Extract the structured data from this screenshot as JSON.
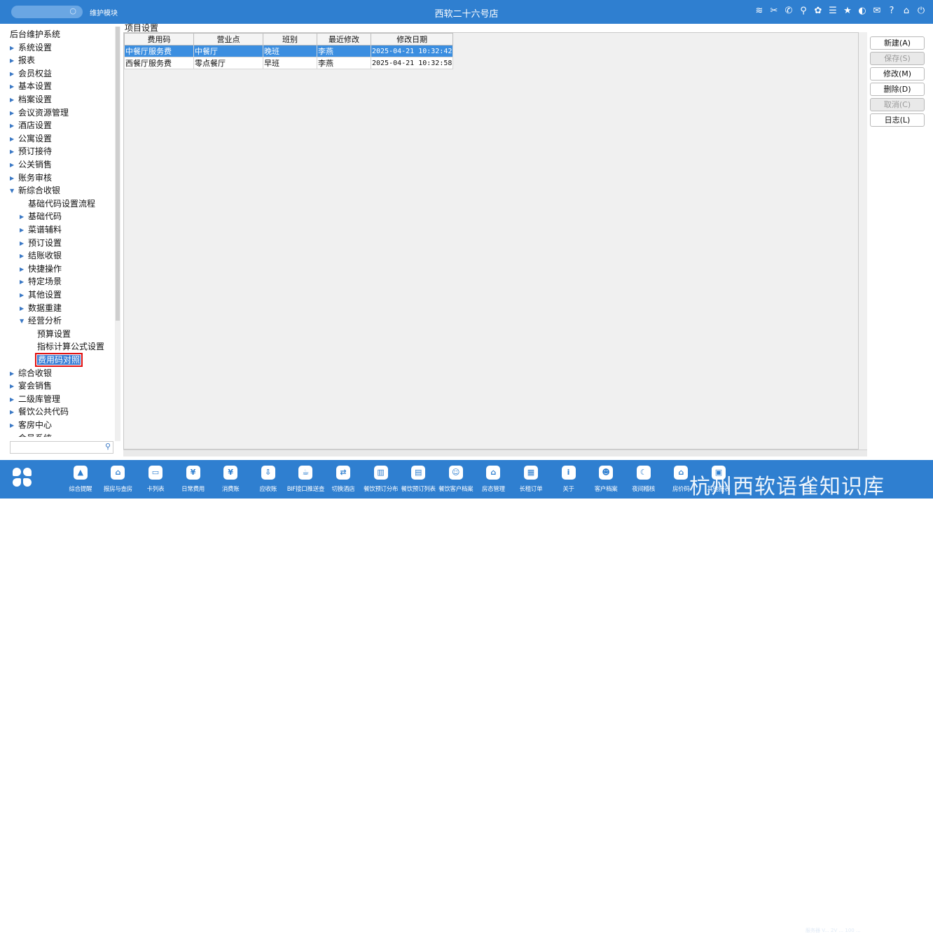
{
  "topbar": {
    "module": "维护模块",
    "title": "西软二十六号店",
    "icons": [
      "wifi-icon",
      "tools-icon",
      "phone-icon",
      "help-search-icon",
      "palette-icon",
      "menu-icon",
      "star-icon",
      "theme-icon",
      "mail-icon",
      "question-icon",
      "home-icon",
      "power-icon"
    ]
  },
  "tree": {
    "root": "后台维护系统",
    "items": [
      {
        "label": "系统设置",
        "arrow": "▶"
      },
      {
        "label": "报表",
        "arrow": "▶"
      },
      {
        "label": "会员权益",
        "arrow": "▶"
      },
      {
        "label": "基本设置",
        "arrow": "▶"
      },
      {
        "label": "档案设置",
        "arrow": "▶"
      },
      {
        "label": "会议资源管理",
        "arrow": "▶"
      },
      {
        "label": "酒店设置",
        "arrow": "▶"
      },
      {
        "label": "公寓设置",
        "arrow": "▶"
      },
      {
        "label": "预订接待",
        "arrow": "▶"
      },
      {
        "label": "公关销售",
        "arrow": "▶"
      },
      {
        "label": "账务审核",
        "arrow": "▶"
      },
      {
        "label": "新综合收银",
        "arrow": "▼"
      },
      {
        "label": "基础代码设置流程",
        "arrow": ""
      },
      {
        "label": "基础代码",
        "arrow": "▶"
      },
      {
        "label": "菜谱辅料",
        "arrow": "▶"
      },
      {
        "label": "预订设置",
        "arrow": "▶"
      },
      {
        "label": "结账收银",
        "arrow": "▶"
      },
      {
        "label": "快捷操作",
        "arrow": "▶"
      },
      {
        "label": "特定场景",
        "arrow": "▶"
      },
      {
        "label": "其他设置",
        "arrow": "▶"
      },
      {
        "label": "数据重建",
        "arrow": "▶"
      },
      {
        "label": "经营分析",
        "arrow": "▼"
      },
      {
        "label": "预算设置",
        "arrow": ""
      },
      {
        "label": "指标计算公式设置",
        "arrow": ""
      },
      {
        "label": "费用码对照",
        "arrow": ""
      },
      {
        "label": "综合收银",
        "arrow": "▶"
      },
      {
        "label": "宴会销售",
        "arrow": "▶"
      },
      {
        "label": "二级库管理",
        "arrow": "▶"
      },
      {
        "label": "餐饮公共代码",
        "arrow": "▶"
      },
      {
        "label": "客房中心",
        "arrow": "▶"
      },
      {
        "label": "会员系统",
        "arrow": "▶"
      }
    ]
  },
  "main": {
    "caption": "项目设置",
    "columns": [
      "费用码",
      "营业点",
      "班别",
      "最近修改",
      "修改日期"
    ],
    "rows": [
      [
        "中餐厅服务费",
        "中餐厅",
        "晚班",
        "李燕",
        "2025-04-21 10:32:42"
      ],
      [
        "西餐厅服务费",
        "零点餐厅",
        "早班",
        "李燕",
        "2025-04-21 10:32:58"
      ]
    ]
  },
  "buttons": {
    "new": "新建(A)",
    "save": "保存(S)",
    "modify": "修改(M)",
    "delete": "删除(D)",
    "cancel": "取消(C)",
    "log": "日志(L)"
  },
  "bottombar": {
    "tools": [
      {
        "label": "综合提醒",
        "icon": "bell-icon",
        "glyph": "▲"
      },
      {
        "label": "报房与查房",
        "icon": "room-check-icon",
        "glyph": "⌂"
      },
      {
        "label": "卡列表",
        "icon": "card-icon",
        "glyph": "▭"
      },
      {
        "label": "日常费用",
        "icon": "receipt-icon",
        "glyph": "¥"
      },
      {
        "label": "消费账",
        "icon": "bill-icon",
        "glyph": "¥"
      },
      {
        "label": "应收账",
        "icon": "receivable-icon",
        "glyph": "⇩"
      },
      {
        "label": "BIF接口推送查",
        "icon": "cup-icon",
        "glyph": "☕"
      },
      {
        "label": "切换酒店",
        "icon": "switch-icon",
        "glyph": "⇄"
      },
      {
        "label": "餐饮预订分布",
        "icon": "chart-icon",
        "glyph": "▥"
      },
      {
        "label": "餐饮预订列表",
        "icon": "list-icon",
        "glyph": "▤"
      },
      {
        "label": "餐饮客户档案",
        "icon": "user-icon",
        "glyph": "☺"
      },
      {
        "label": "房态管理",
        "icon": "house-icon",
        "glyph": "⌂"
      },
      {
        "label": "长租订单",
        "icon": "lease-icon",
        "glyph": "▦"
      },
      {
        "label": "关于",
        "icon": "info-icon",
        "glyph": "i"
      },
      {
        "label": "客户档案",
        "icon": "profile-icon",
        "glyph": "☻"
      },
      {
        "label": "夜间稽核",
        "icon": "moon-icon",
        "glyph": "☾"
      },
      {
        "label": "房价码",
        "icon": "rate-icon",
        "glyph": "⌂"
      },
      {
        "label": "其他报表",
        "icon": "report-icon",
        "glyph": "▣"
      }
    ],
    "watermark": "杭州西软语雀知识库",
    "status": "服务器 V... 2V ... 100 ..."
  }
}
